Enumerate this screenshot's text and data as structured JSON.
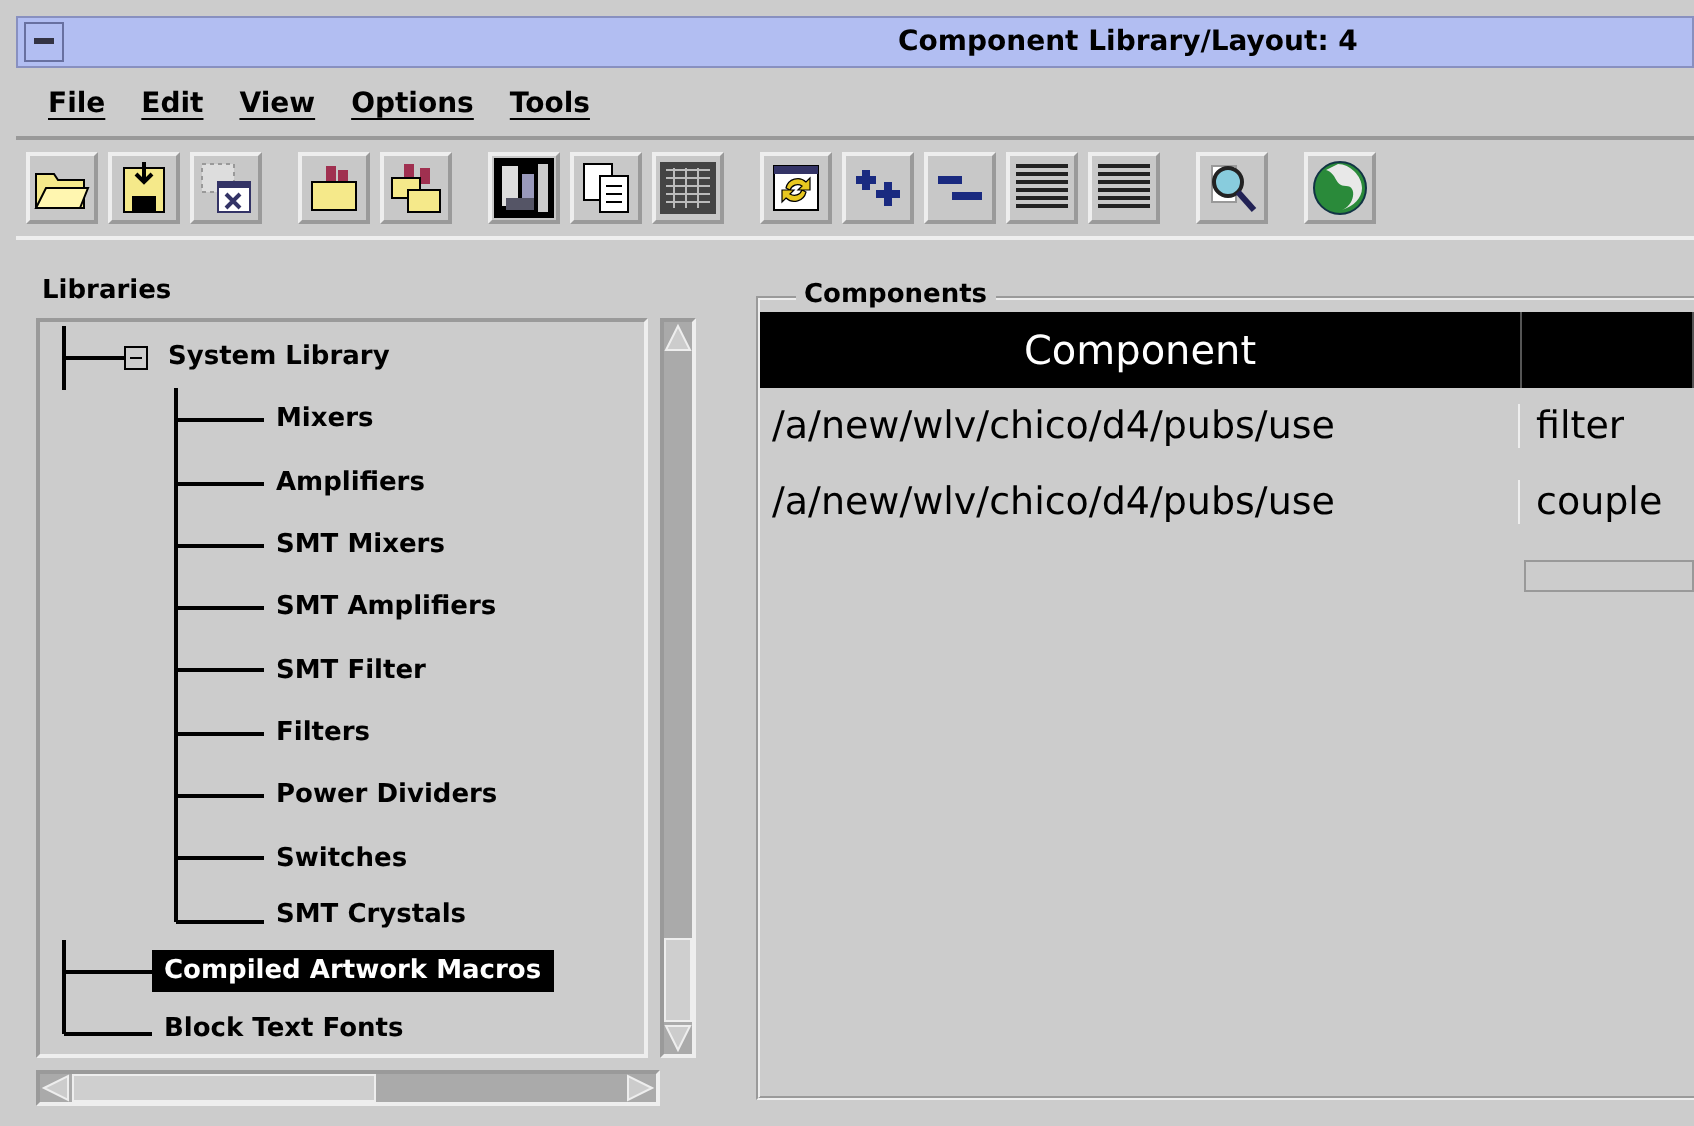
{
  "window": {
    "title": "Component Library/Layout: 4"
  },
  "menu": [
    {
      "label": "File"
    },
    {
      "label": "Edit"
    },
    {
      "label": "View"
    },
    {
      "label": "Options"
    },
    {
      "label": "Tools"
    }
  ],
  "libraries": {
    "label": "Libraries",
    "tree": [
      {
        "label": "System Library",
        "expanded": true,
        "selected": false,
        "children": [
          {
            "label": "Mixers",
            "selected": false
          },
          {
            "label": "Amplifiers",
            "selected": false
          },
          {
            "label": "SMT Mixers",
            "selected": false
          },
          {
            "label": "SMT Amplifiers",
            "selected": false
          },
          {
            "label": "SMT Filter",
            "selected": false
          },
          {
            "label": "Filters",
            "selected": false
          },
          {
            "label": "Power Dividers",
            "selected": false
          },
          {
            "label": "Switches",
            "selected": false
          },
          {
            "label": "SMT Crystals",
            "selected": false
          }
        ]
      },
      {
        "label": "Compiled Artwork Macros",
        "selected": true
      },
      {
        "label": "Block Text Fonts",
        "selected": false
      }
    ]
  },
  "components": {
    "label": "Components",
    "columns": [
      "Component",
      ""
    ],
    "rows": [
      [
        "/a/new/wlv/chico/d4/pubs/use",
        "filter"
      ],
      [
        "/a/new/wlv/chico/d4/pubs/use",
        "couple"
      ]
    ]
  }
}
